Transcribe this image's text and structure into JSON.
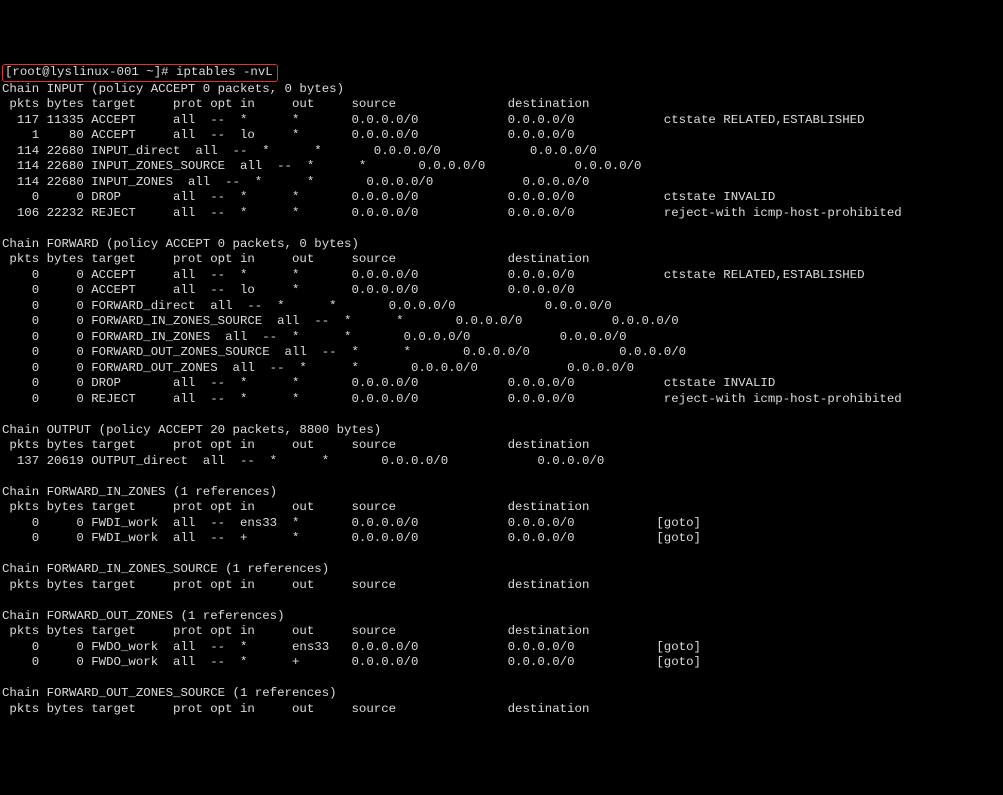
{
  "prompt_prefix": "[root@lyslinux-001 ~]# ",
  "command": "iptables -nvL",
  "chains": [
    {
      "header": "Chain INPUT (policy ACCEPT 0 packets, 0 bytes)",
      "cols": " pkts bytes target     prot opt in     out     source               destination         ",
      "rows": [
        "  117 11335 ACCEPT     all  --  *      *       0.0.0.0/0            0.0.0.0/0            ctstate RELATED,ESTABLISHED",
        "    1    80 ACCEPT     all  --  lo     *       0.0.0.0/0            0.0.0.0/0           ",
        "  114 22680 INPUT_direct  all  --  *      *       0.0.0.0/0            0.0.0.0/0           ",
        "  114 22680 INPUT_ZONES_SOURCE  all  --  *      *       0.0.0.0/0            0.0.0.0/0           ",
        "  114 22680 INPUT_ZONES  all  --  *      *       0.0.0.0/0            0.0.0.0/0           ",
        "    0     0 DROP       all  --  *      *       0.0.0.0/0            0.0.0.0/0            ctstate INVALID",
        "  106 22232 REJECT     all  --  *      *       0.0.0.0/0            0.0.0.0/0            reject-with icmp-host-prohibited"
      ]
    },
    {
      "header": "Chain FORWARD (policy ACCEPT 0 packets, 0 bytes)",
      "cols": " pkts bytes target     prot opt in     out     source               destination         ",
      "rows": [
        "    0     0 ACCEPT     all  --  *      *       0.0.0.0/0            0.0.0.0/0            ctstate RELATED,ESTABLISHED",
        "    0     0 ACCEPT     all  --  lo     *       0.0.0.0/0            0.0.0.0/0           ",
        "    0     0 FORWARD_direct  all  --  *      *       0.0.0.0/0            0.0.0.0/0           ",
        "    0     0 FORWARD_IN_ZONES_SOURCE  all  --  *      *       0.0.0.0/0            0.0.0.0/0           ",
        "    0     0 FORWARD_IN_ZONES  all  --  *      *       0.0.0.0/0            0.0.0.0/0           ",
        "    0     0 FORWARD_OUT_ZONES_SOURCE  all  --  *      *       0.0.0.0/0            0.0.0.0/0           ",
        "    0     0 FORWARD_OUT_ZONES  all  --  *      *       0.0.0.0/0            0.0.0.0/0           ",
        "    0     0 DROP       all  --  *      *       0.0.0.0/0            0.0.0.0/0            ctstate INVALID",
        "    0     0 REJECT     all  --  *      *       0.0.0.0/0            0.0.0.0/0            reject-with icmp-host-prohibited"
      ]
    },
    {
      "header": "Chain OUTPUT (policy ACCEPT 20 packets, 8800 bytes)",
      "cols": " pkts bytes target     prot opt in     out     source               destination         ",
      "rows": [
        "  137 20619 OUTPUT_direct  all  --  *      *       0.0.0.0/0            0.0.0.0/0           "
      ]
    },
    {
      "header": "Chain FORWARD_IN_ZONES (1 references)",
      "cols": " pkts bytes target     prot opt in     out     source               destination         ",
      "rows": [
        "    0     0 FWDI_work  all  --  ens33  *       0.0.0.0/0            0.0.0.0/0           [goto] ",
        "    0     0 FWDI_work  all  --  +      *       0.0.0.0/0            0.0.0.0/0           [goto] "
      ]
    },
    {
      "header": "Chain FORWARD_IN_ZONES_SOURCE (1 references)",
      "cols": " pkts bytes target     prot opt in     out     source               destination         ",
      "rows": []
    },
    {
      "header": "Chain FORWARD_OUT_ZONES (1 references)",
      "cols": " pkts bytes target     prot opt in     out     source               destination         ",
      "rows": [
        "    0     0 FWDO_work  all  --  *      ens33   0.0.0.0/0            0.0.0.0/0           [goto] ",
        "    0     0 FWDO_work  all  --  *      +       0.0.0.0/0            0.0.0.0/0           [goto] "
      ]
    },
    {
      "header": "Chain FORWARD_OUT_ZONES_SOURCE (1 references)",
      "cols": " pkts bytes target     prot opt in     out     source               destination         ",
      "rows": []
    }
  ]
}
